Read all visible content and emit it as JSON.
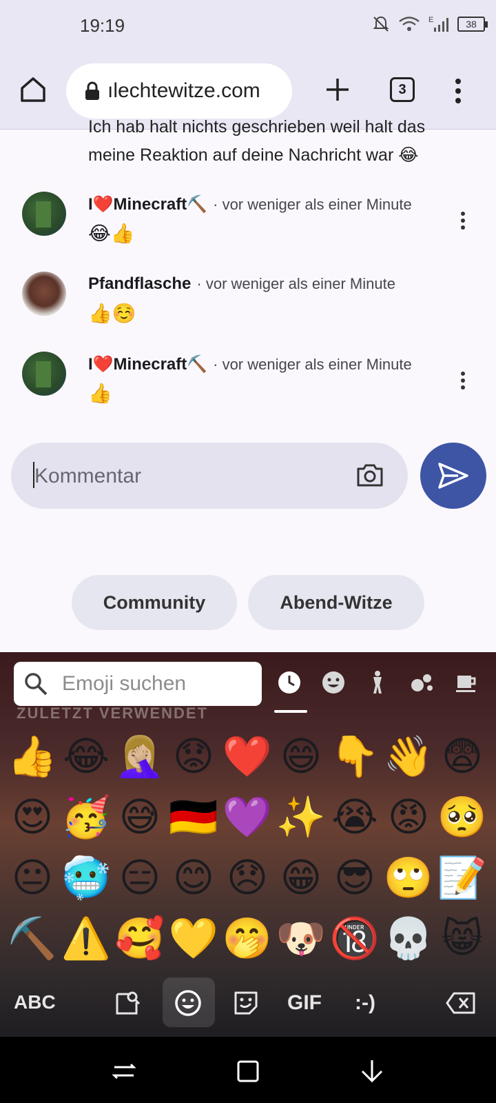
{
  "status_bar": {
    "time": "19:19",
    "battery": "38",
    "network": "E"
  },
  "browser": {
    "url": "ılechtewitze.com",
    "tab_count": "3"
  },
  "comments": [
    {
      "text_line1": "Ich hab halt nichts geschrieben weil halt das",
      "text_line2": "meine Reaktion auf deine Nachricht war 😂"
    },
    {
      "author": "I❤️Minecraft⛏️",
      "meta": "· vor weniger als einer Minute",
      "reaction": "😂👍"
    },
    {
      "author": "Pfandflasche",
      "meta": "· vor weniger als einer Minute",
      "reaction": "👍☺️"
    },
    {
      "author": "I❤️Minecraft⛏️",
      "meta": "· vor weniger als einer Minute",
      "reaction": "👍"
    }
  ],
  "comment_input": {
    "placeholder": "Kommentar"
  },
  "chips": [
    "Community",
    "Abend-Witze"
  ],
  "keyboard": {
    "search_placeholder": "Emoji suchen",
    "section_label": "ZULETZT VERWENDET",
    "emojis": [
      "👍",
      "😂",
      "🤦🏼‍♀️",
      "😟",
      "❤️",
      "😄",
      "👇",
      "👋",
      "😨",
      "😍",
      "🥳",
      "😅",
      "🇩🇪",
      "💜",
      "✨",
      "😭",
      "😡",
      "🥺",
      "😐",
      "🥶",
      "😑",
      "😊",
      "😞",
      "😁",
      "😎",
      "🙄",
      "📝",
      "⛏️",
      "⚠️",
      "🥰",
      "💛",
      "🤭",
      "🐶",
      "🔞",
      "💀",
      "😸"
    ],
    "abc_label": "ABC",
    "gif_label": "GIF",
    "emoticon_label": ":-)"
  }
}
